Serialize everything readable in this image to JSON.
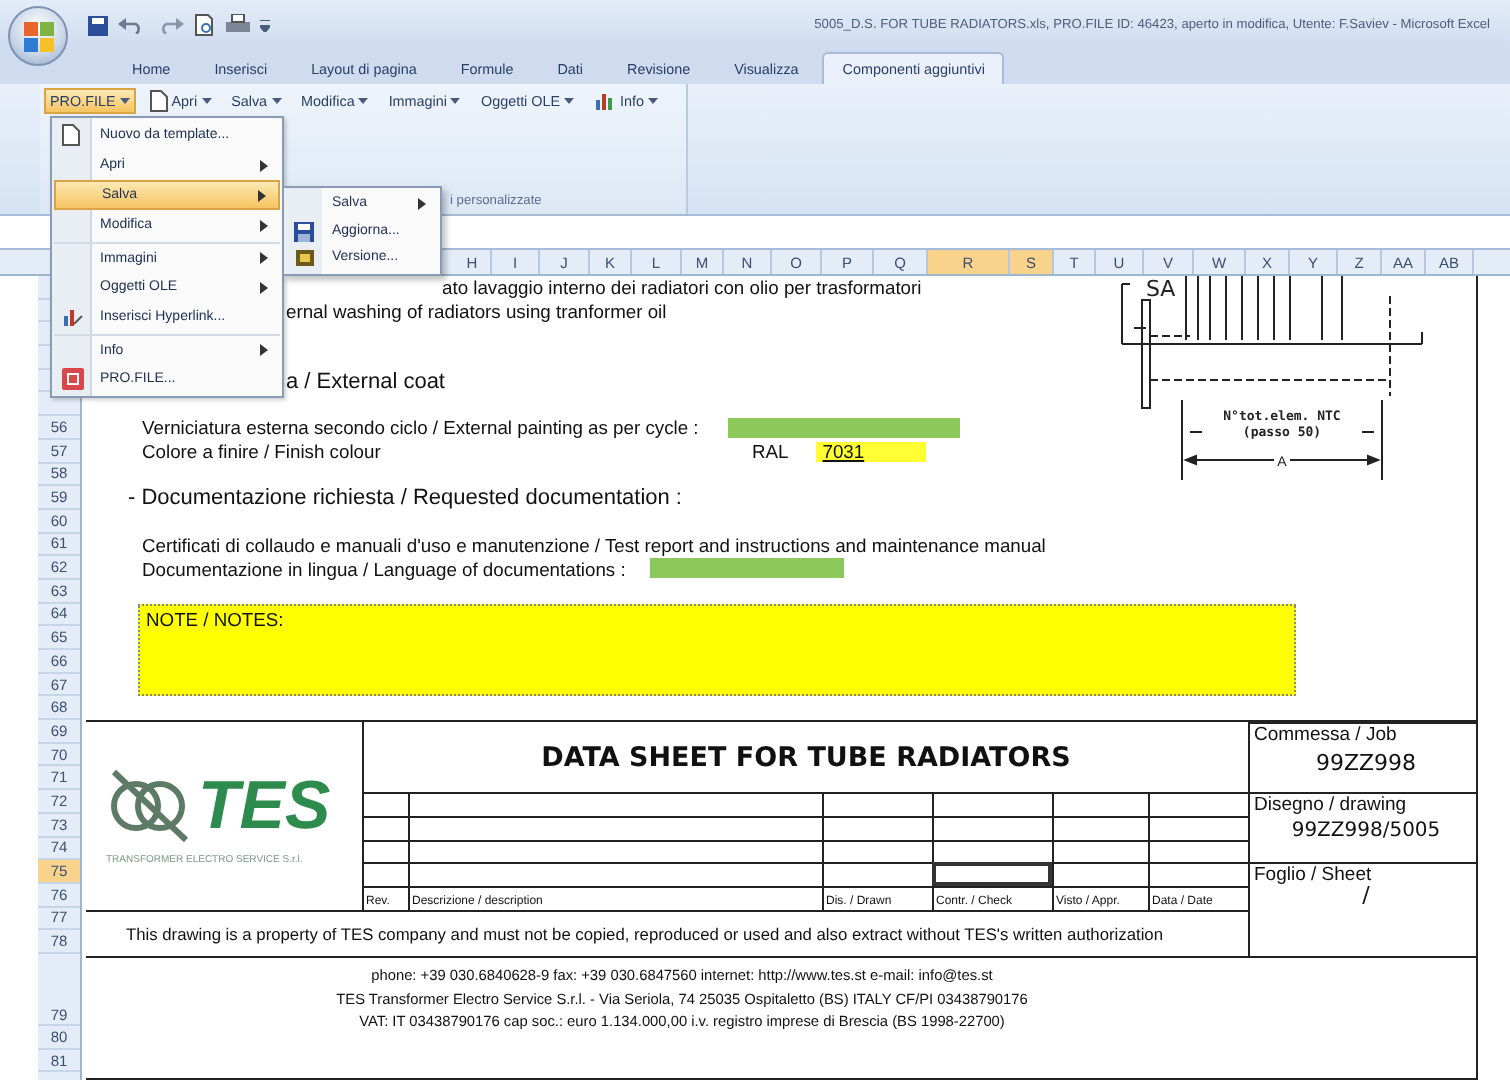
{
  "window": {
    "title": "5005_D.S. FOR TUBE RADIATORS.xls, PRO.FILE ID: 46423, aperto in modifica, Utente: F.Saviev - Microsoft Excel"
  },
  "tabs": [
    {
      "label": "Home",
      "selected": false
    },
    {
      "label": "Inserisci",
      "selected": false
    },
    {
      "label": "Layout di pagina",
      "selected": false
    },
    {
      "label": "Formule",
      "selected": false
    },
    {
      "label": "Dati",
      "selected": false
    },
    {
      "label": "Revisione",
      "selected": false
    },
    {
      "label": "Visualizza",
      "selected": false
    },
    {
      "label": "Componenti aggiuntivi",
      "selected": true
    }
  ],
  "toolbar": [
    {
      "label": "PRO.FILE",
      "kind": "menu-button",
      "selected": true
    },
    {
      "label": "Apri",
      "kind": "icon-dropdown",
      "selected": false
    },
    {
      "label": "Salva",
      "kind": "dropdown",
      "selected": false
    },
    {
      "label": "Modifica",
      "kind": "dropdown",
      "selected": false
    },
    {
      "label": "Immagini",
      "kind": "dropdown",
      "selected": false
    },
    {
      "label": "Oggetti OLE",
      "kind": "dropdown",
      "selected": false
    },
    {
      "label": "Info",
      "kind": "icon-dropdown",
      "selected": false
    }
  ],
  "ribbon_group": {
    "label": "i personalizzate"
  },
  "menu": [
    {
      "label": "Nuovo da template...",
      "submenu": false,
      "selected": false,
      "separator_before": false
    },
    {
      "label": "Apri",
      "submenu": true,
      "selected": false,
      "separator_before": false
    },
    {
      "label": "Salva",
      "submenu": true,
      "selected": true,
      "separator_before": false
    },
    {
      "label": "Modifica",
      "submenu": true,
      "selected": false,
      "separator_before": false
    },
    {
      "label": "Immagini",
      "submenu": true,
      "selected": false,
      "separator_before": true
    },
    {
      "label": "Oggetti OLE",
      "submenu": true,
      "selected": false,
      "separator_before": false
    },
    {
      "label": "Inserisci Hyperlink...",
      "submenu": false,
      "selected": false,
      "separator_before": false
    },
    {
      "label": "Info",
      "submenu": true,
      "selected": false,
      "separator_before": true
    },
    {
      "label": "PRO.FILE...",
      "submenu": false,
      "selected": false,
      "separator_before": false
    }
  ],
  "submenu": [
    {
      "label": "Salva",
      "submenu": true,
      "selected": false
    },
    {
      "label": "Aggiorna...",
      "submenu": false,
      "selected": false
    },
    {
      "label": "Versione...",
      "submenu": false,
      "selected": false
    }
  ],
  "columns": [
    {
      "label": "H",
      "selected": false
    },
    {
      "label": "I",
      "selected": false
    },
    {
      "label": "J",
      "selected": false
    },
    {
      "label": "K",
      "selected": false
    },
    {
      "label": "L",
      "selected": false
    },
    {
      "label": "M",
      "selected": false
    },
    {
      "label": "N",
      "selected": false
    },
    {
      "label": "O",
      "selected": false
    },
    {
      "label": "P",
      "selected": false
    },
    {
      "label": "Q",
      "selected": false
    },
    {
      "label": "R",
      "selected": true
    },
    {
      "label": "S",
      "selected": true
    },
    {
      "label": "T",
      "selected": false
    },
    {
      "label": "U",
      "selected": false
    },
    {
      "label": "V",
      "selected": false
    },
    {
      "label": "W",
      "selected": false
    },
    {
      "label": "X",
      "selected": false
    },
    {
      "label": "Y",
      "selected": false
    },
    {
      "label": "Z",
      "selected": false
    },
    {
      "label": "AA",
      "selected": false
    },
    {
      "label": "AB",
      "selected": false
    }
  ],
  "rows": [
    {
      "label": "56",
      "selected": false
    },
    {
      "label": "57",
      "selected": false
    },
    {
      "label": "58",
      "selected": false
    },
    {
      "label": "59",
      "selected": false
    },
    {
      "label": "60",
      "selected": false
    },
    {
      "label": "61",
      "selected": false
    },
    {
      "label": "62",
      "selected": false
    },
    {
      "label": "63",
      "selected": false
    },
    {
      "label": "64",
      "selected": false
    },
    {
      "label": "65",
      "selected": false
    },
    {
      "label": "66",
      "selected": false
    },
    {
      "label": "67",
      "selected": false
    },
    {
      "label": "68",
      "selected": false
    },
    {
      "label": "69",
      "selected": false
    },
    {
      "label": "70",
      "selected": false
    },
    {
      "label": "71",
      "selected": false
    },
    {
      "label": "72",
      "selected": false
    },
    {
      "label": "73",
      "selected": false
    },
    {
      "label": "74",
      "selected": false
    },
    {
      "label": "75",
      "selected": true
    },
    {
      "label": "76",
      "selected": false
    },
    {
      "label": "77",
      "selected": false
    },
    {
      "label": "78",
      "selected": false
    },
    {
      "label": "79",
      "selected": false
    },
    {
      "label": "80",
      "selected": false
    },
    {
      "label": "81",
      "selected": false
    }
  ],
  "sheet": {
    "washing_it": "ato lavaggio interno dei radiatori con olio per trasformatori",
    "washing_en": "ernal washing of radiators using tranformer oil",
    "coat_heading": "a / External coat",
    "painting_label": "Verniciatura esterna secondo ciclo / External painting as per cycle :",
    "colour_label": "Colore a finire / Finish colour",
    "ral_label": "RAL",
    "ral_value": "7031",
    "documentation_heading": "- Documentazione richiesta / Requested documentation :",
    "certificates": "Certificati di collaudo e manuali d'uso e manutenzione / Test report and instructions and maintenance manual",
    "language_label": "Documentazione in lingua / Language of documentations :",
    "notes_label": "NOTE  / NOTES:"
  },
  "radiator_drawing": {
    "labels": [
      "SA",
      "N°tot.elem. NTC",
      "(passo 50)",
      "A"
    ]
  },
  "title_block": {
    "logo_text": "TES",
    "company": "TRANSFORMER ELECTRO SERVICE S.r.l.",
    "title": "DATA SHEET FOR TUBE RADIATORS",
    "revision_rows": [
      [
        {
          "selected": false
        },
        {
          "selected": false
        },
        {
          "selected": false
        },
        {
          "selected": false
        },
        {
          "selected": false
        },
        {
          "selected": false
        }
      ],
      [
        {
          "selected": false
        },
        {
          "selected": false
        },
        {
          "selected": false
        },
        {
          "selected": false
        },
        {
          "selected": false
        },
        {
          "selected": false
        }
      ],
      [
        {
          "selected": false
        },
        {
          "selected": false
        },
        {
          "selected": false
        },
        {
          "selected": false
        },
        {
          "selected": false
        },
        {
          "selected": false
        }
      ],
      [
        {
          "selected": false
        },
        {
          "selected": false
        },
        {
          "selected": false
        },
        {
          "selected": true
        },
        {
          "selected": false
        },
        {
          "selected": false
        }
      ]
    ],
    "revision_columns": [
      "Rev.",
      "Descrizione / description",
      "Dis. / Drawn",
      "Contr. / Check",
      "Visto / Appr.",
      "Data / Date"
    ],
    "job_label": "Commessa / Job",
    "job": "99ZZ998",
    "drawing_label": "Disegno / drawing",
    "drawing": "99ZZ998/5005",
    "sheet_label": "Foglio / Sheet",
    "sheet": "/",
    "disclaimer": "This drawing is a property of TES company and must not be copied, reproduced or used and also extract without TES's written authorization",
    "contacts": [
      "phone: +39 030.6840628-9  fax: +39 030.6847560  internet: http://www.tes.st  e-mail: info@tes.st",
      "TES Transformer Electro Service S.r.l. - Via Seriola, 74 25035 Ospitaletto (BS) ITALY  CF/PI 03438790176",
      "VAT: IT 03438790176  cap soc.: euro 1.134.000,00 i.v. registro imprese di Brescia (BS 1998-22700)"
    ]
  }
}
